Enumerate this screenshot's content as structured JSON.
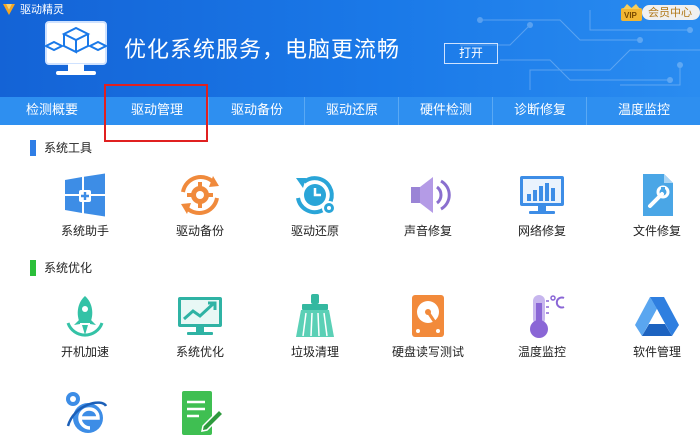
{
  "app": {
    "title": "驱动精灵"
  },
  "member": {
    "label": "会员中心"
  },
  "banner": {
    "headline": "优化系统服务，电脑更流畅",
    "open_button": "打开"
  },
  "tabs": [
    {
      "label": "检测概要"
    },
    {
      "label": "驱动管理"
    },
    {
      "label": "驱动备份"
    },
    {
      "label": "驱动还原"
    },
    {
      "label": "硬件检测"
    },
    {
      "label": "诊断修复"
    },
    {
      "label": "温度监控"
    }
  ],
  "sections": [
    {
      "title": "系统工具",
      "color": "#2f7ee6",
      "tools": [
        {
          "label": "系统助手",
          "icon": "windows-plus-icon"
        },
        {
          "label": "驱动备份",
          "icon": "gear-cycle-icon"
        },
        {
          "label": "驱动还原",
          "icon": "clock-restore-icon"
        },
        {
          "label": "声音修复",
          "icon": "speaker-icon"
        },
        {
          "label": "网络修复",
          "icon": "monitor-chart-icon"
        },
        {
          "label": "文件修复",
          "icon": "file-wrench-icon"
        }
      ]
    },
    {
      "title": "系统优化",
      "color": "#2bbf3a",
      "tools": [
        {
          "label": "开机加速",
          "icon": "rocket-icon"
        },
        {
          "label": "系统优化",
          "icon": "monitor-trend-icon"
        },
        {
          "label": "垃圾清理",
          "icon": "broom-icon"
        },
        {
          "label": "硬盘读写测试",
          "icon": "hard-disk-icon"
        },
        {
          "label": "温度监控",
          "icon": "thermometer-icon"
        },
        {
          "label": "软件管理",
          "icon": "triangle-app-icon"
        }
      ]
    }
  ],
  "partial_tools": [
    {
      "icon": "ie-settings-icon"
    },
    {
      "icon": "document-pencil-icon"
    }
  ]
}
